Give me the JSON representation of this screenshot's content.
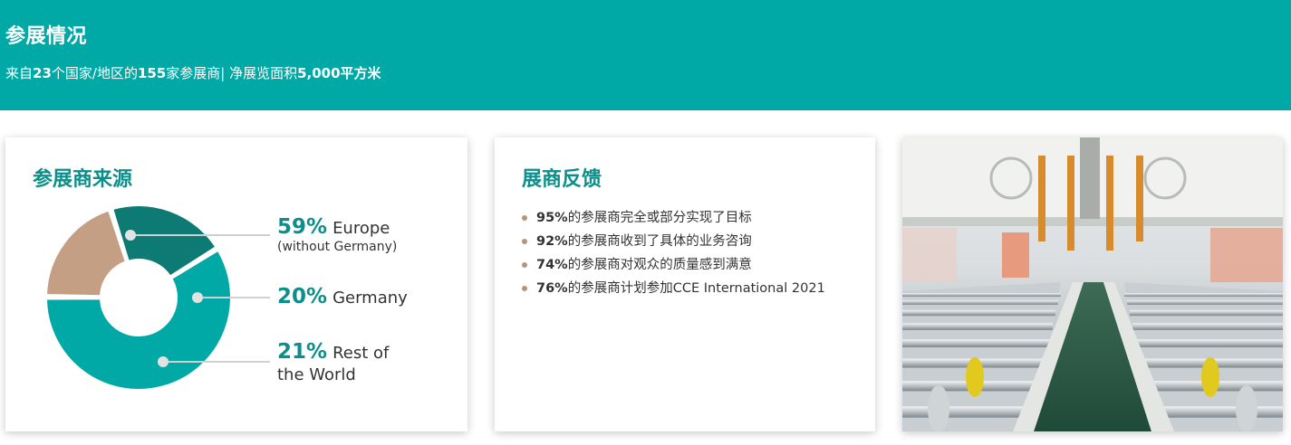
{
  "banner": {
    "title": "参展情况",
    "subtitle_parts": {
      "p1": "来自",
      "countries": "23",
      "p2": "个国家/地区的",
      "exhibitors": "155",
      "p3": "家参展商| 净展览面积",
      "area": "5,000",
      "p4": "平方米"
    }
  },
  "source_card": {
    "title": "参展商来源",
    "segments": [
      {
        "pct": "59%",
        "label": "Europe",
        "sub": "(without Germany)",
        "value": 59,
        "color": "#00a9a5"
      },
      {
        "pct": "20%",
        "label": "Germany",
        "value": 20,
        "color": "#c49f84"
      },
      {
        "pct": "21%",
        "label": "Rest of",
        "label_line2": "the World",
        "value": 21,
        "color": "#0d7a73"
      }
    ],
    "connector_color": "#d0d0d0"
  },
  "feedback_card": {
    "title": "展商反馈",
    "items": [
      {
        "pct": "95%",
        "text": "的参展商完全或部分实现了目标"
      },
      {
        "pct": "92%",
        "text": "的参展商收到了具体的业务咨询"
      },
      {
        "pct": "74%",
        "text": "的参展商对观众的质量感到满意"
      },
      {
        "pct": "76%",
        "text": "的参展商计划参加CCE International 2021"
      }
    ],
    "bullet_color": "#b6937a"
  },
  "photo_card": {
    "subject": "industrial-conveyor-machine-photo"
  },
  "colors": {
    "brand_teal": "#00a9a5",
    "title_teal": "#0b8f8b"
  }
}
